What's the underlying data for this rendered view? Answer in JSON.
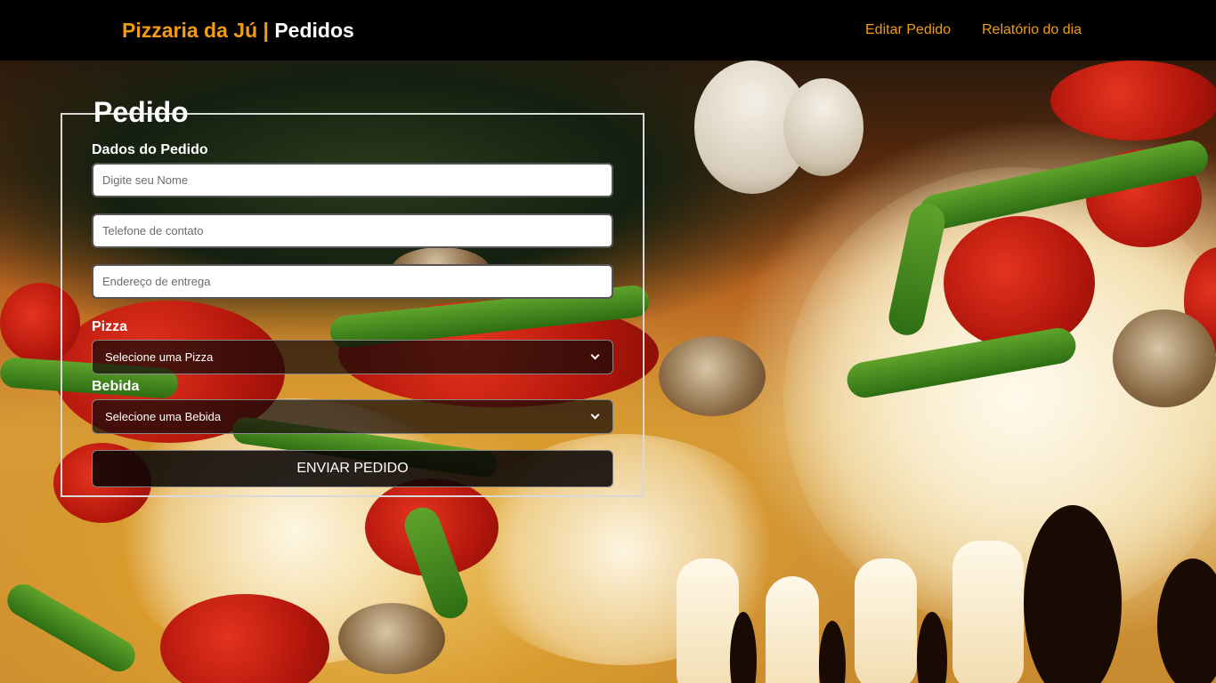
{
  "header": {
    "brand_accent": "Pizzaria da Jú |",
    "brand_white": "Pedidos",
    "nav": [
      {
        "label": "Editar Pedido"
      },
      {
        "label": "Relatório do dia"
      }
    ]
  },
  "form": {
    "legend": "Pedido",
    "section_title": "Dados do Pedido",
    "inputs": {
      "name_placeholder": "Digite seu Nome",
      "phone_placeholder": "Telefone de contato",
      "address_placeholder": "Endereço de entrega"
    },
    "pizza_label": "Pizza",
    "pizza_selected": "Selecione uma Pizza",
    "drink_label": "Bebida",
    "drink_selected": "Selecione uma Bebida",
    "submit_label": "ENVIAR PEDIDO"
  },
  "colors": {
    "accent": "#f39c12",
    "header_bg": "#000000",
    "text": "#ffffff"
  }
}
